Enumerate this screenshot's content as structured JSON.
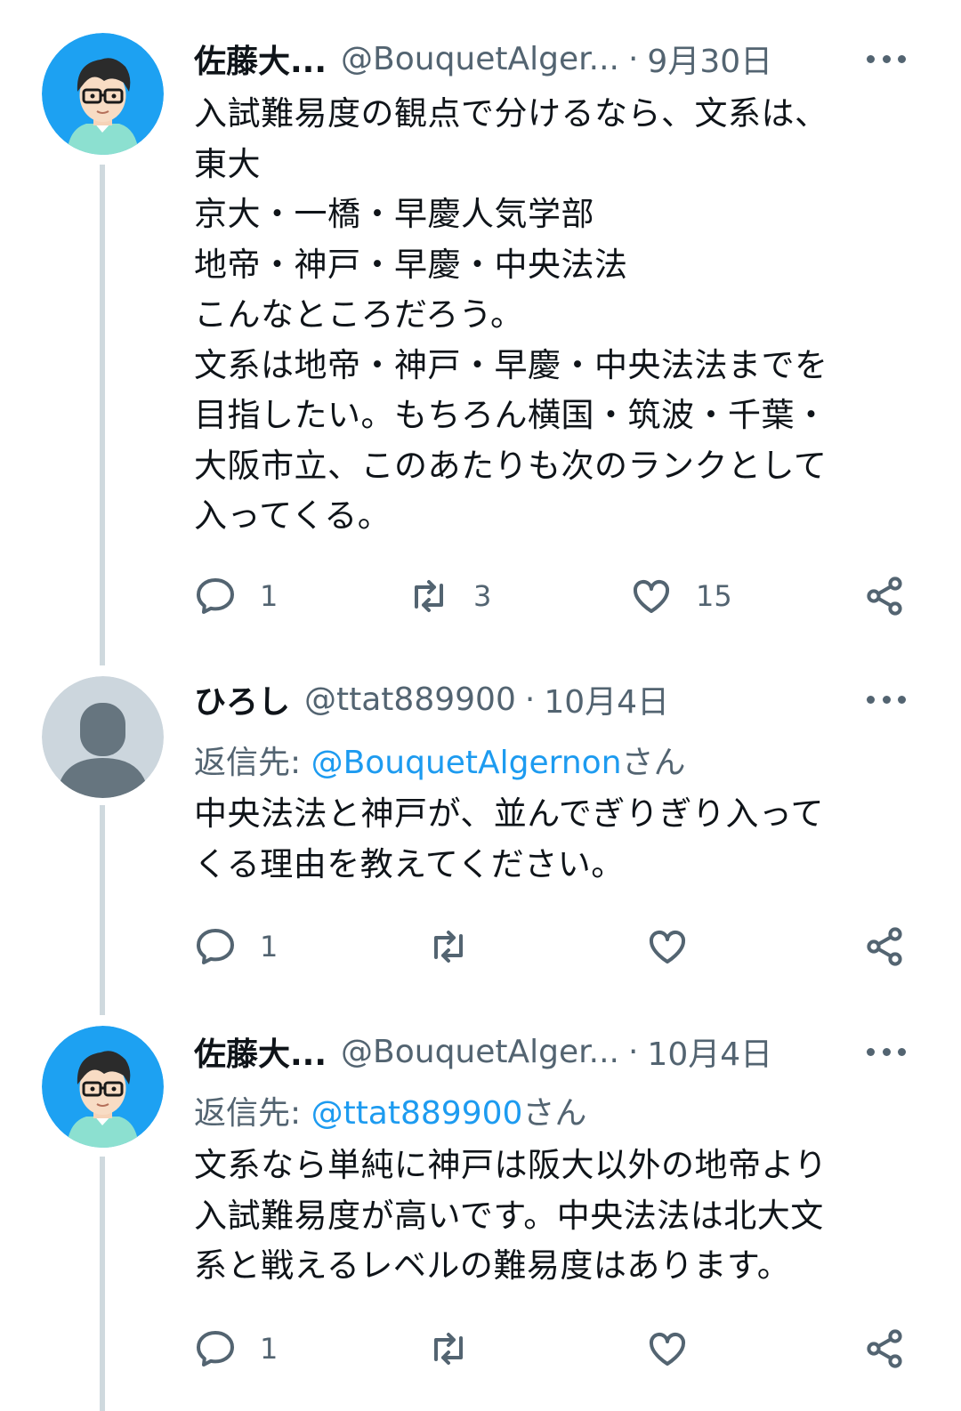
{
  "tweets": [
    {
      "name": "佐藤大...",
      "handle": "@BouquetAlger...",
      "date": "9月30日",
      "reply_prefix": "",
      "reply_mention": "",
      "reply_suffix": "",
      "text": "入試難易度の観点で分けるなら、文系は、\n東大\n京大・一橋・早慶人気学部\n地帝・神戸・早慶・中央法法\nこんなところだろう。\n文系は地帝・神戸・早慶・中央法法までを\n目指したい。もちろん横国・筑波・千葉・\n大阪市立、このあたりも次のランクとして\n入ってくる。",
      "actions": {
        "reply": "1",
        "retweet": "3",
        "like": "15"
      }
    },
    {
      "name": "ひろし",
      "handle": "@ttat889900",
      "date": "10月4日",
      "reply_prefix": "返信先: ",
      "reply_mention": "@BouquetAlgernon",
      "reply_suffix": "さん",
      "text": "中央法法と神戸が、並んでぎりぎり入って\nくる理由を教えてください。",
      "actions": {
        "reply": "1",
        "retweet": "",
        "like": ""
      }
    },
    {
      "name": "佐藤大...",
      "handle": "@BouquetAlger...",
      "date": "10月4日",
      "reply_prefix": "返信先: ",
      "reply_mention": "@ttat889900",
      "reply_suffix": "さん",
      "text": "文系なら単純に神戸は阪大以外の地帝より\n入試難易度が高いです。中央法法は北大文\n系と戦えるレベルの難易度はあります。",
      "actions": {
        "reply": "1",
        "retweet": "",
        "like": ""
      }
    }
  ],
  "colors": {
    "text": "#0f1419",
    "secondary": "#536471",
    "link": "#1d9bf0",
    "thread_line": "#cfd9de",
    "avatar_bg": "#1da1f2"
  },
  "icons": [
    "more-icon",
    "reply-icon",
    "retweet-icon",
    "like-icon",
    "share-icon",
    "avatar-icon",
    "default-avatar-icon"
  ]
}
